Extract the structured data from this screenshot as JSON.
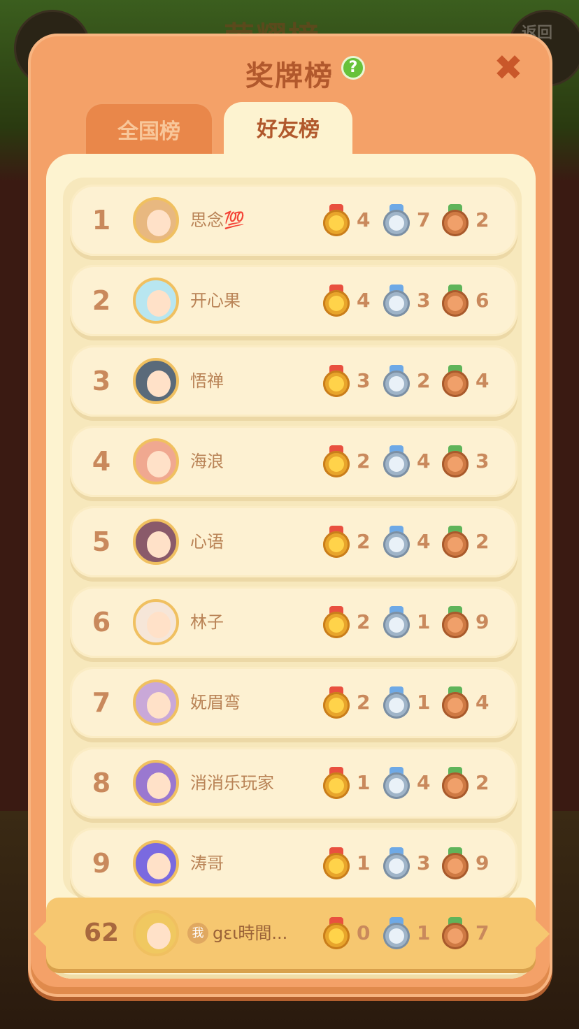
{
  "background": {
    "title": "荣耀榜",
    "back_label": "返回"
  },
  "panel": {
    "title": "奖牌榜",
    "help_glyph": "?",
    "close_glyph": "✖"
  },
  "tabs": [
    {
      "label": "全国榜",
      "active": false
    },
    {
      "label": "好友榜",
      "active": true
    }
  ],
  "rows": [
    {
      "rank": "1",
      "name": "思念💯",
      "gold": "4",
      "silver": "7",
      "bronze": "2",
      "avatar_color": "#e8b880"
    },
    {
      "rank": "2",
      "name": "开心果",
      "gold": "4",
      "silver": "3",
      "bronze": "6",
      "avatar_color": "#b8e6f0"
    },
    {
      "rank": "3",
      "name": "悟禅",
      "gold": "3",
      "silver": "2",
      "bronze": "4",
      "avatar_color": "#5a6a7a"
    },
    {
      "rank": "4",
      "name": "海浪",
      "gold": "2",
      "silver": "4",
      "bronze": "3",
      "avatar_color": "#f0a890"
    },
    {
      "rank": "5",
      "name": "心语",
      "gold": "2",
      "silver": "4",
      "bronze": "2",
      "avatar_color": "#8a5a6a"
    },
    {
      "rank": "6",
      "name": "林子",
      "gold": "2",
      "silver": "1",
      "bronze": "9",
      "avatar_color": "#f6e6d8"
    },
    {
      "rank": "7",
      "name": "妩眉弯",
      "gold": "2",
      "silver": "1",
      "bronze": "4",
      "avatar_color": "#c9a8d8"
    },
    {
      "rank": "8",
      "name": "消消乐玩家",
      "gold": "1",
      "silver": "4",
      "bronze": "2",
      "avatar_color": "#9a78d0"
    },
    {
      "rank": "9",
      "name": "涛哥",
      "gold": "1",
      "silver": "3",
      "bronze": "9",
      "avatar_color": "#7a6ae0"
    }
  ],
  "self": {
    "rank": "62",
    "me_badge": "我",
    "name": "gεɩ時間...",
    "gold": "0",
    "silver": "1",
    "bronze": "7",
    "avatar_color": "#f0c860"
  },
  "colors": {
    "panel": "#f4a168",
    "title": "#b1582c",
    "row": "#fdf1d2",
    "rank": "#c9895c"
  }
}
